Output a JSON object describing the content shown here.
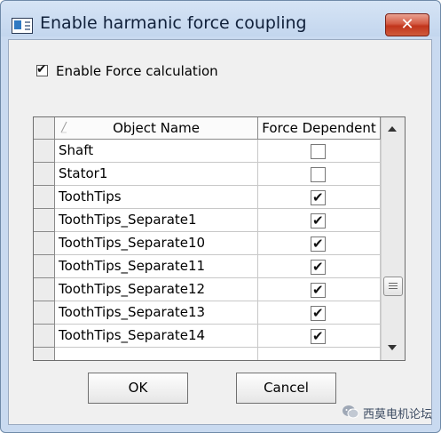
{
  "window": {
    "title": "Enable harmanic force coupling",
    "close_label": "✕"
  },
  "options": {
    "enable_force_label": "Enable Force calculation",
    "enable_force_checked": true
  },
  "grid": {
    "columns": [
      "Object Name",
      "Force Dependent"
    ],
    "rows": [
      {
        "name": "Shaft",
        "force_dependent": false
      },
      {
        "name": "Stator1",
        "force_dependent": false
      },
      {
        "name": "ToothTips",
        "force_dependent": true
      },
      {
        "name": "ToothTips_Separate1",
        "force_dependent": true
      },
      {
        "name": "ToothTips_Separate10",
        "force_dependent": true
      },
      {
        "name": "ToothTips_Separate11",
        "force_dependent": true
      },
      {
        "name": "ToothTips_Separate12",
        "force_dependent": true
      },
      {
        "name": "ToothTips_Separate13",
        "force_dependent": true
      },
      {
        "name": "ToothTips_Separate14",
        "force_dependent": true
      }
    ],
    "check_glyph": "✔"
  },
  "buttons": {
    "ok_label": "OK",
    "cancel_label": "Cancel"
  },
  "watermark": {
    "text": "西莫电机论坛"
  },
  "colors": {
    "title_bar": "#c9daf0",
    "close_button": "#c9462f",
    "dialog_bg": "#f0f0f0"
  },
  "icons": [
    "app-window-icon",
    "close-icon",
    "sort-indicator-icon",
    "scroll-up-arrow-icon",
    "scroll-down-arrow-icon",
    "scroll-grip-icon",
    "wechat-icon"
  ]
}
